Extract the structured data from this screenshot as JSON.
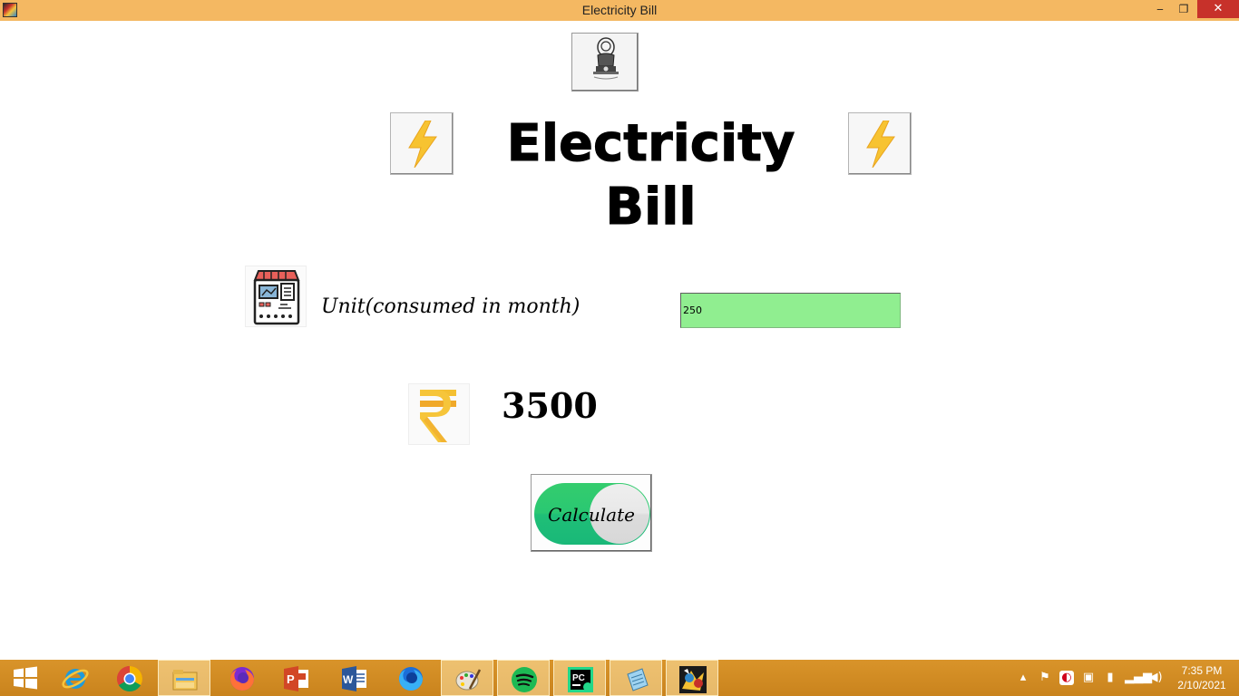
{
  "window": {
    "title": "Electricity Bill",
    "minimize": "‒",
    "maximize": "❐",
    "close": "✕"
  },
  "heading": "Electricity Bill",
  "form": {
    "unit_label": "Unit(consumed in month)",
    "unit_value": "250"
  },
  "result": {
    "amount": "3500"
  },
  "calculate_button": "Calculate",
  "taskbar": {
    "apps": [
      "start",
      "internet-explorer",
      "chrome",
      "file-explorer",
      "firefox",
      "powerpoint",
      "word",
      "firefox-developer",
      "paint",
      "spotify",
      "pycharm",
      "notepad",
      "python-tkinter-app"
    ],
    "active_apps": [
      "file-explorer",
      "paint",
      "spotify",
      "pycharm",
      "notepad",
      "python-tkinter-app"
    ],
    "clock_time": "7:35 PM",
    "clock_date": "2/10/2021"
  },
  "colors": {
    "titlebar": "#f4b862",
    "input_bg": "#90ee90",
    "taskbar": "#d08b22",
    "calc_green": "#2ac872",
    "close_red": "#c7312a"
  }
}
